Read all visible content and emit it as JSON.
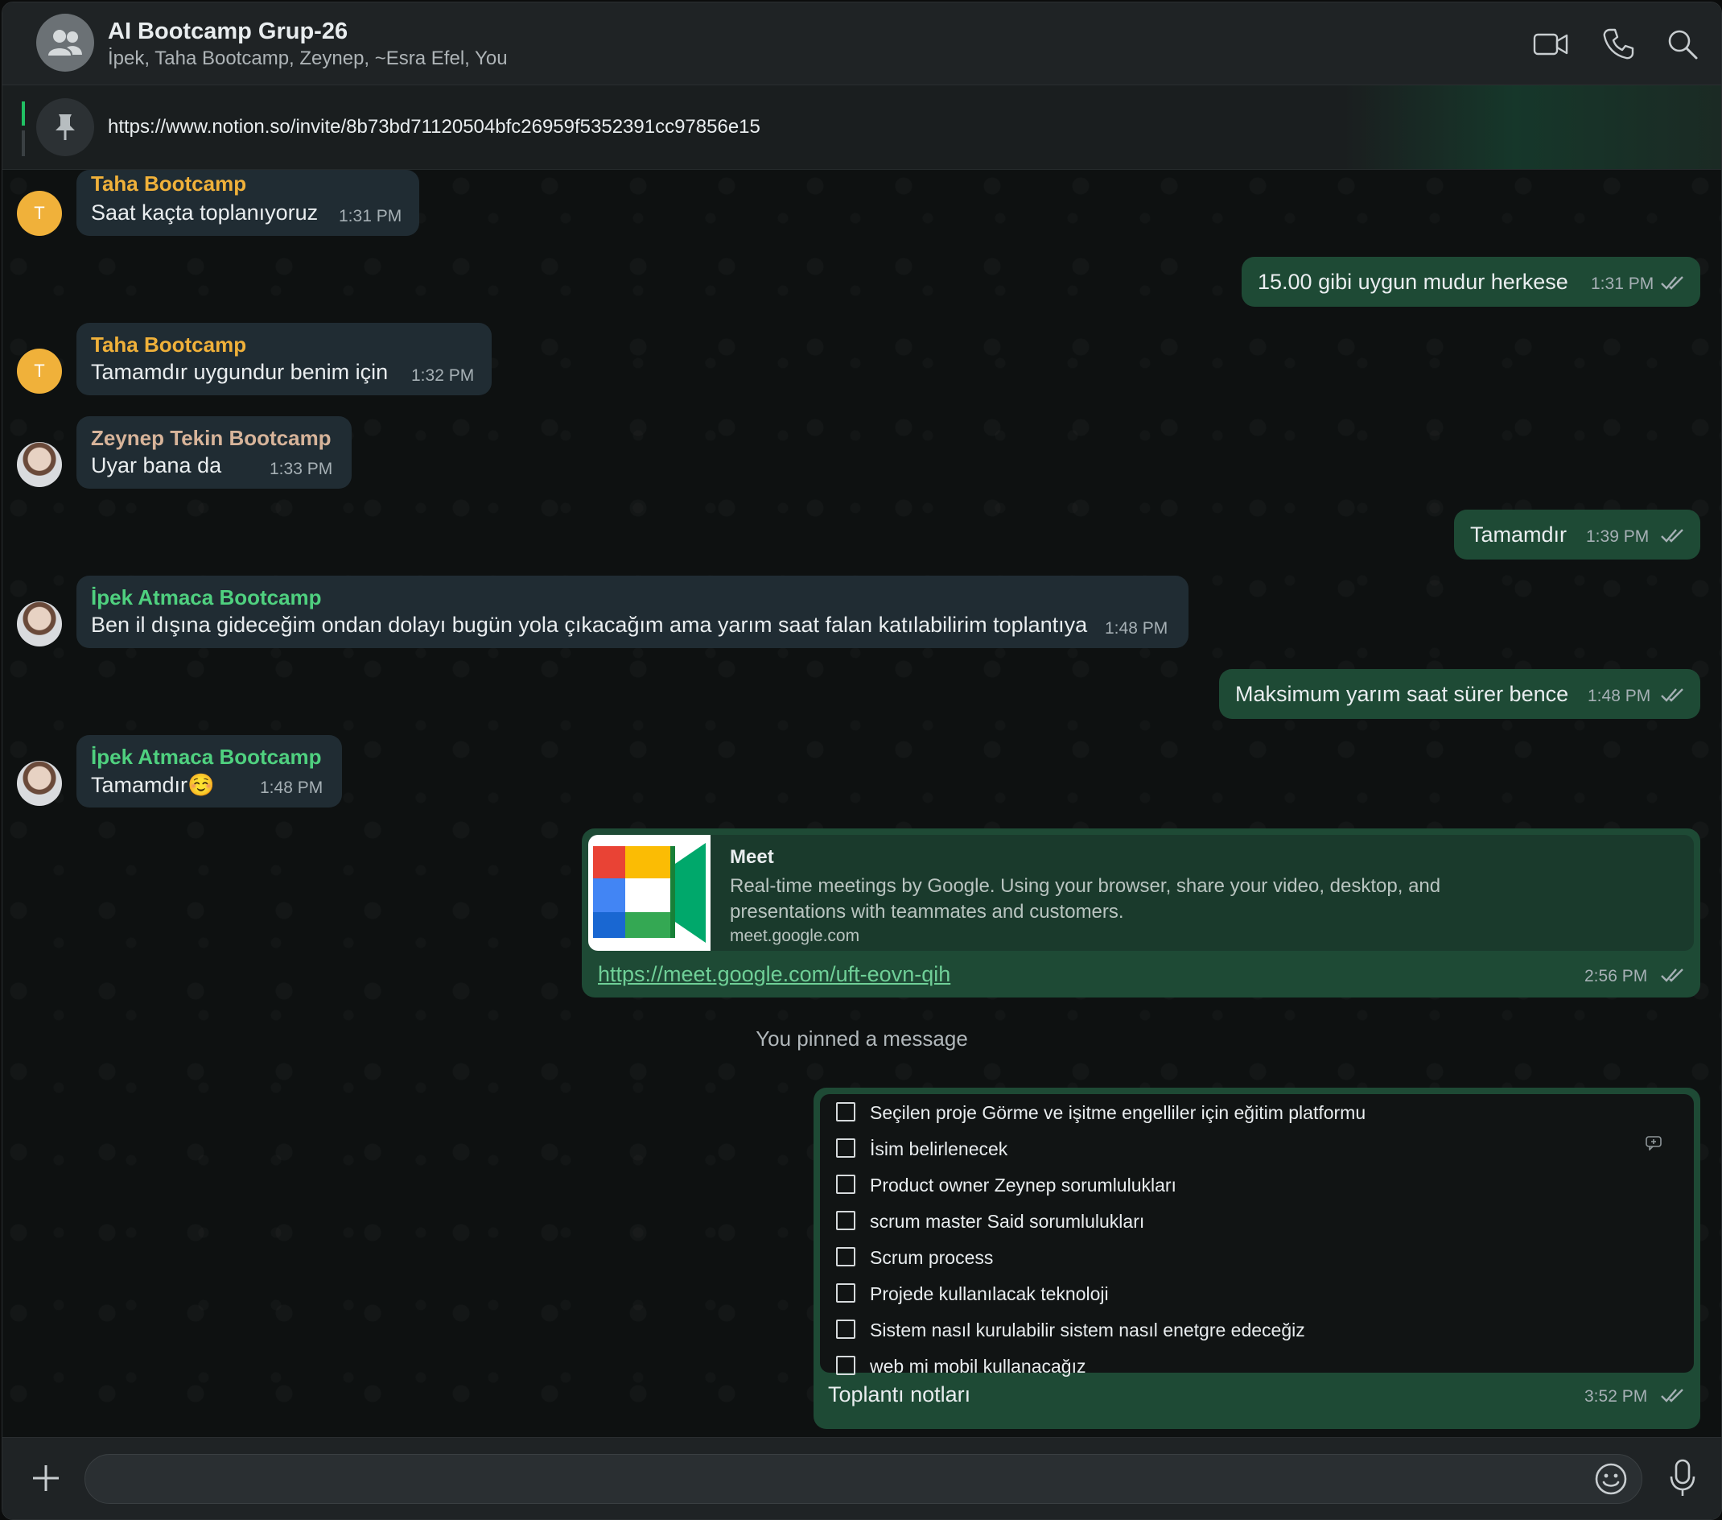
{
  "header": {
    "title": "AI Bootcamp Grup-26",
    "members": "İpek, Taha Bootcamp, Zeynep, ~Esra Efel, You",
    "icons": [
      "video-call-icon",
      "voice-call-icon",
      "search-icon"
    ]
  },
  "pinned": {
    "text": "https://www.notion.so/invite/8b73bd71120504bfc26959f5352391cc97856e15"
  },
  "messages": [
    {
      "sender": "Taha Bootcamp",
      "text": "Saat kaçta toplanıyoruz",
      "time": "1:31 PM",
      "avatar": "T"
    },
    {
      "text": "15.00 gibi uygun mudur herkese",
      "time": "1:31 PM"
    },
    {
      "sender": "Taha Bootcamp",
      "text": "Tamamdır uygundur benim için",
      "time": "1:32 PM",
      "avatar": "T"
    },
    {
      "sender": "Zeynep Tekin Bootcamp",
      "text": "Uyar bana da",
      "time": "1:33 PM"
    },
    {
      "text": "Tamamdır",
      "time": "1:39 PM"
    },
    {
      "sender": "İpek Atmaca Bootcamp",
      "text": "Ben il dışına gideceğim ondan dolayı bugün yola çıkacağım ama yarım saat falan katılabilirim toplantıya",
      "time": "1:48 PM"
    },
    {
      "text": "Maksimum yarım saat sürer bence",
      "time": "1:48 PM"
    },
    {
      "sender": "İpek Atmaca Bootcamp",
      "text": "Tamamdır",
      "emoji": "☺️",
      "time": "1:48 PM"
    }
  ],
  "meet_card": {
    "title": "Meet",
    "description": "Real-time meetings by Google. Using your browser, share your video, desktop, and presentations with teammates and customers.",
    "domain": "meet.google.com",
    "link": "https://meet.google.com/uft-eovn-qih",
    "time": "2:56 PM"
  },
  "system_message": "You pinned a message",
  "notes_card": {
    "items": [
      "Seçilen proje Görme ve işitme engelliler için eğitim platformu",
      "İsim belirlenecek",
      "Product owner Zeynep sorumlulukları",
      "scrum master Said sorumlulukları",
      "Scrum process",
      "Projede kullanılacak teknoloji",
      "Sistem nasıl kurulabilir sistem nasıl enetgre edeceğiz",
      "web mi mobil kullanacağız"
    ],
    "caption": "Toplantı notları",
    "time": "3:52 PM"
  },
  "colors": {
    "outgoing_bubble": "#1e4a35",
    "incoming_bubble": "#202c33",
    "sender_taha": "#f0b13a",
    "sender_zeynep": "#d7b49a",
    "sender_ipek": "#4fd07f"
  }
}
